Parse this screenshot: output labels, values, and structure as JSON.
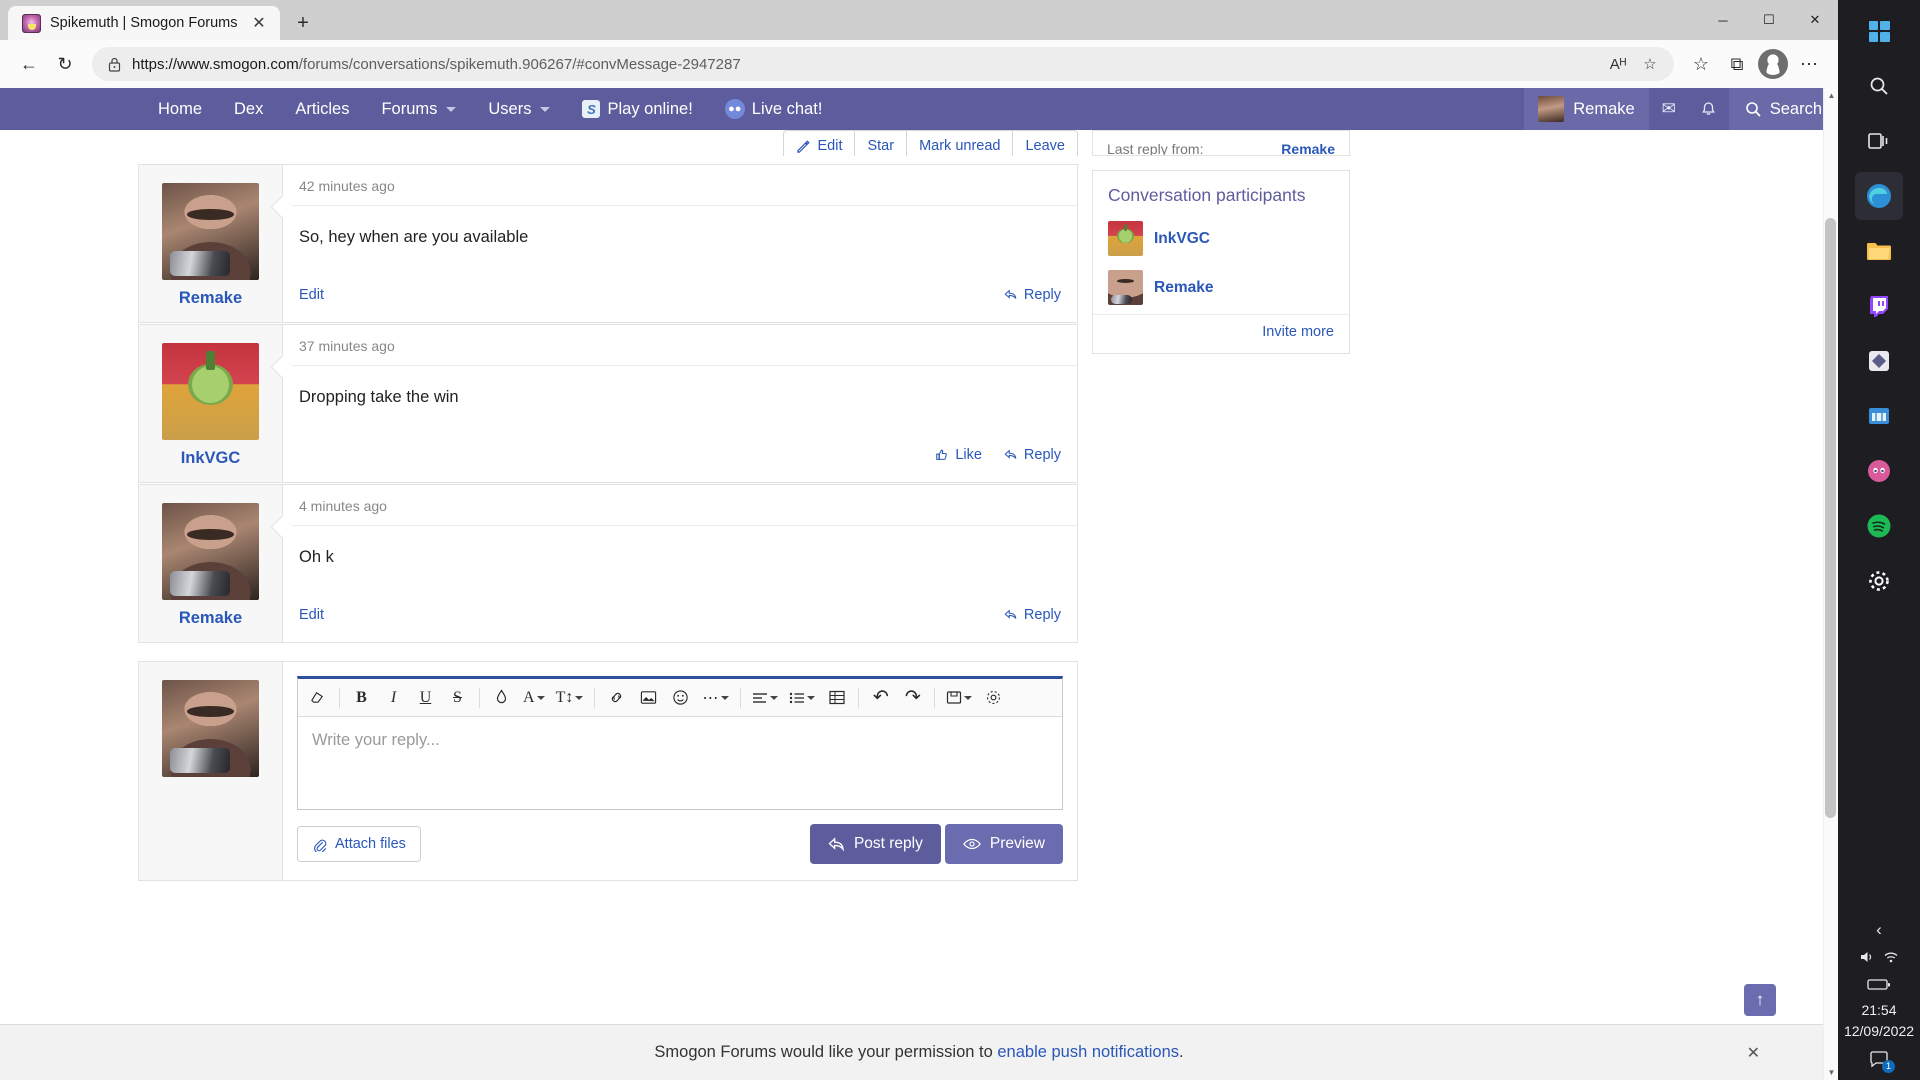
{
  "browser": {
    "tab": {
      "title": "Spikemuth | Smogon Forums",
      "close_label": "✕",
      "favicon": "pokemon-favicon"
    },
    "new_tab_label": "+",
    "window_controls": {
      "minimize": "─",
      "maximize": "☐",
      "close": "✕"
    },
    "nav": {
      "back": "←",
      "forward": "→",
      "reload": "↻"
    },
    "address": {
      "lock_icon": "lock-icon",
      "url_prefix": "https://www.smogon.com",
      "url_path": "/forums/conversations/spikemuth.906267/#convMessage-2947287",
      "read_aloud": "Aᴴ",
      "favorite": "☆",
      "collections_star": "☆",
      "collections": "⧉",
      "settings_more": "⋯"
    }
  },
  "site_nav": {
    "items": [
      {
        "label": "Home",
        "has_caret": false,
        "icon": ""
      },
      {
        "label": "Dex",
        "has_caret": false,
        "icon": ""
      },
      {
        "label": "Articles",
        "has_caret": false,
        "icon": ""
      },
      {
        "label": "Forums",
        "has_caret": true,
        "icon": ""
      },
      {
        "label": "Users",
        "has_caret": true,
        "icon": ""
      },
      {
        "label": "Play online!",
        "has_caret": false,
        "icon": "pokemon-showdown-icon"
      },
      {
        "label": "Live chat!",
        "has_caret": false,
        "icon": "discord-icon"
      }
    ],
    "user": "Remake",
    "inbox_icon": "✉",
    "alerts_icon": "🔔",
    "search_label": "Search",
    "search_icon": "🔍",
    "accent_color": "#5d5d9e"
  },
  "conversation": {
    "actions": [
      {
        "label": "Edit",
        "icon": "edit-icon"
      },
      {
        "label": "Star",
        "icon": ""
      },
      {
        "label": "Mark unread",
        "icon": ""
      },
      {
        "label": "Leave",
        "icon": ""
      }
    ],
    "messages": [
      {
        "author": "Remake",
        "avatar": "gru-avatar",
        "time": "42 minutes ago",
        "text": "So, hey when are you available",
        "edit_label": "Edit",
        "like_label": "",
        "reply_label": "Reply"
      },
      {
        "author": "InkVGC",
        "avatar": "ink-avatar",
        "time": "37 minutes ago",
        "text": "Dropping take the win",
        "edit_label": "",
        "like_label": "Like",
        "reply_label": "Reply"
      },
      {
        "author": "Remake",
        "avatar": "gru-avatar",
        "time": "4 minutes ago",
        "text": "Oh k",
        "edit_label": "Edit",
        "like_label": "",
        "reply_label": "Reply"
      }
    ]
  },
  "editor": {
    "placeholder": "Write your reply...",
    "toolbar": [
      {
        "name": "remove-formatting-icon",
        "glyph": "◇",
        "caret": false
      },
      {
        "name": "bold-icon",
        "glyph": "B",
        "caret": false
      },
      {
        "name": "italic-icon",
        "glyph": "I",
        "caret": false
      },
      {
        "name": "underline-icon",
        "glyph": "U",
        "caret": false
      },
      {
        "name": "strikethrough-icon",
        "glyph": "S",
        "caret": false
      },
      {
        "name": "text-color-icon",
        "glyph": "◆",
        "caret": false
      },
      {
        "name": "font-family-icon",
        "glyph": "A",
        "caret": true
      },
      {
        "name": "font-size-icon",
        "glyph": "T",
        "caret": true
      },
      {
        "name": "insert-link-icon",
        "glyph": "🔗",
        "caret": false
      },
      {
        "name": "insert-image-icon",
        "glyph": "▣",
        "caret": false
      },
      {
        "name": "emoji-icon",
        "glyph": "☺",
        "caret": false
      },
      {
        "name": "more-options-icon",
        "glyph": "⋯",
        "caret": true
      },
      {
        "name": "text-align-icon",
        "glyph": "≡",
        "caret": true
      },
      {
        "name": "list-icon",
        "glyph": "☰",
        "caret": true
      },
      {
        "name": "insert-table-icon",
        "glyph": "⊞",
        "caret": false
      },
      {
        "name": "undo-icon",
        "glyph": "↶",
        "caret": false
      },
      {
        "name": "redo-icon",
        "glyph": "↷",
        "caret": false
      },
      {
        "name": "draft-icon",
        "glyph": "❐",
        "caret": true
      },
      {
        "name": "editor-settings-icon",
        "glyph": "⚙",
        "caret": false
      }
    ],
    "attach_label": "Attach files",
    "attach_icon": "paperclip-icon",
    "post_label": "Post reply",
    "post_icon": "reply-arrow-icon",
    "preview_label": "Preview",
    "preview_icon": "eye-icon"
  },
  "sidebar": {
    "last_reply_label": "Last reply from:",
    "last_reply_user": "Remake",
    "participants_title": "Conversation participants",
    "participants": [
      {
        "name": "InkVGC",
        "avatar": "ink-avatar"
      },
      {
        "name": "Remake",
        "avatar": "gru-avatar"
      }
    ],
    "invite_label": "Invite more"
  },
  "push_banner": {
    "text_before": "Smogon Forums would like your permission to ",
    "link": "enable push notifications",
    "text_after": ".",
    "close_icon": "✕"
  },
  "back_to_top": {
    "icon": "↑"
  },
  "taskbar": {
    "icons": [
      {
        "name": "start-icon",
        "glyph": ""
      },
      {
        "name": "search-icon",
        "glyph": "○"
      },
      {
        "name": "task-view-icon",
        "glyph": "▦"
      },
      {
        "name": "edge-icon",
        "glyph": "e"
      },
      {
        "name": "file-explorer-icon",
        "glyph": "📁"
      },
      {
        "name": "twitch-icon",
        "glyph": "▶"
      },
      {
        "name": "app-icon",
        "glyph": "◆"
      },
      {
        "name": "microsoft-store-icon",
        "glyph": "⊞"
      },
      {
        "name": "discord-icon",
        "glyph": "◑"
      },
      {
        "name": "spotify-icon",
        "glyph": "♪"
      },
      {
        "name": "settings-icon",
        "glyph": "⚙"
      }
    ],
    "chevron_icon": "‹",
    "volume_icon": "🔊",
    "wifi_icon": "◠",
    "battery_icon": "▭",
    "time": "21:54",
    "date": "12/09/2022",
    "notification_icon": "💬",
    "notification_count": "1"
  }
}
